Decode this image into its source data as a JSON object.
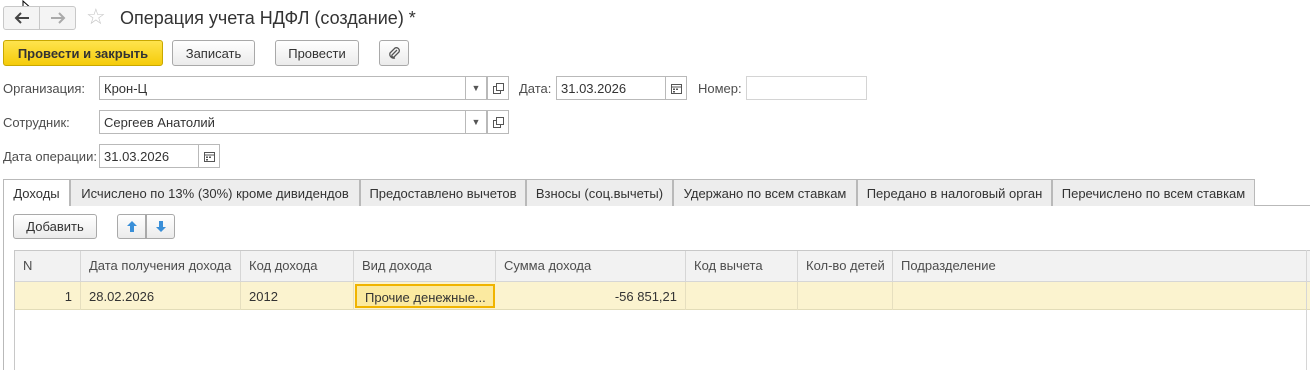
{
  "window": {
    "title": "Операция учета НДФЛ (создание) *",
    "nav_back_icon": "arrow-left-icon",
    "nav_forward_icon": "arrow-right-icon",
    "favorite_icon": "star-icon"
  },
  "toolbar": {
    "post_and_close": "Провести и закрыть",
    "save": "Записать",
    "post": "Провести",
    "attach_icon": "paperclip-icon"
  },
  "form": {
    "organization_label": "Организация:",
    "organization_value": "Крон-Ц",
    "date_label": "Дата:",
    "date_value": "31.03.2026",
    "number_label": "Номер:",
    "number_value": "",
    "employee_label": "Сотрудник:",
    "employee_value": "Сергеев Анатолий",
    "operation_date_label": "Дата операции:",
    "operation_date_value": "31.03.2026"
  },
  "tabs": [
    {
      "label": "Доходы",
      "active": true
    },
    {
      "label": "Исчислено по 13% (30%) кроме дивидендов",
      "active": false
    },
    {
      "label": "Предоставлено вычетов",
      "active": false
    },
    {
      "label": "Взносы (соц.вычеты)",
      "active": false
    },
    {
      "label": "Удержано по всем ставкам",
      "active": false
    },
    {
      "label": "Передано в налоговый орган",
      "active": false
    },
    {
      "label": "Перечислено по всем ставкам",
      "active": false
    }
  ],
  "table_toolbar": {
    "add": "Добавить",
    "move_up_icon": "arrow-up-icon",
    "move_down_icon": "arrow-down-icon"
  },
  "table": {
    "columns": [
      "N",
      "Дата получения дохода",
      "Код дохода",
      "Вид дохода",
      "Сумма дохода",
      "Код вычета",
      "Кол-во детей",
      "Подразделение"
    ],
    "rows": [
      [
        "1",
        "28.02.2026",
        "2012",
        "Прочие денежные...",
        "-56 851,21",
        "",
        "",
        ""
      ]
    ]
  },
  "colors": {
    "primary_button": "#f5cc0a",
    "selected_row": "#fbf3cf",
    "selected_cell_border": "#f0b400"
  }
}
